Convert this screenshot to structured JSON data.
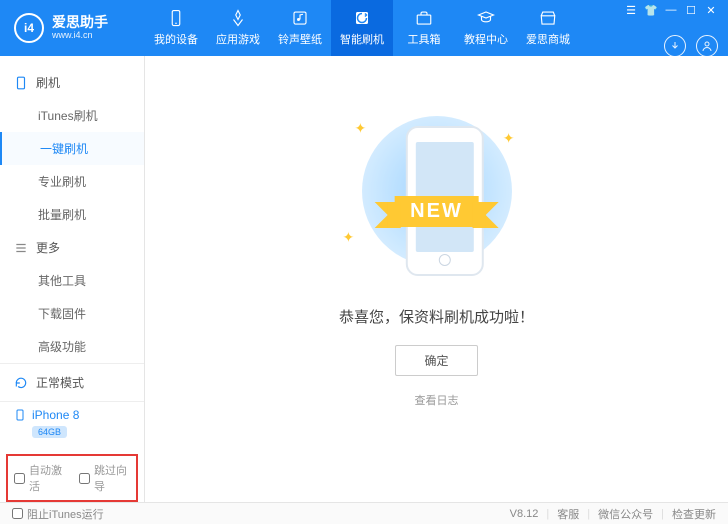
{
  "brand": {
    "logo_text": "i4",
    "title": "爱思助手",
    "subtitle": "www.i4.cn"
  },
  "nav": [
    {
      "label": "我的设备",
      "icon": "device"
    },
    {
      "label": "应用游戏",
      "icon": "apps"
    },
    {
      "label": "铃声壁纸",
      "icon": "ringtone"
    },
    {
      "label": "智能刷机",
      "icon": "flash",
      "active": true
    },
    {
      "label": "工具箱",
      "icon": "toolbox"
    },
    {
      "label": "教程中心",
      "icon": "tutorial"
    },
    {
      "label": "爱思商城",
      "icon": "store"
    }
  ],
  "sidebar": {
    "group1": {
      "title": "刷机",
      "items": [
        "iTunes刷机",
        "一键刷机",
        "专业刷机",
        "批量刷机"
      ],
      "active": 1
    },
    "group2": {
      "title": "更多",
      "items": [
        "其他工具",
        "下载固件",
        "高级功能"
      ]
    }
  },
  "mode": {
    "label": "正常模式"
  },
  "device": {
    "name": "iPhone 8",
    "storage": "64GB"
  },
  "options": {
    "auto_activate": "自动激活",
    "skip_guide": "跳过向导"
  },
  "main": {
    "ribbon": "NEW",
    "success": "恭喜您，保资料刷机成功啦！",
    "ok": "确定",
    "view_log": "查看日志"
  },
  "footer": {
    "block_itunes": "阻止iTunes运行",
    "version": "V8.12",
    "support": "客服",
    "wechat": "微信公众号",
    "update": "检查更新"
  }
}
